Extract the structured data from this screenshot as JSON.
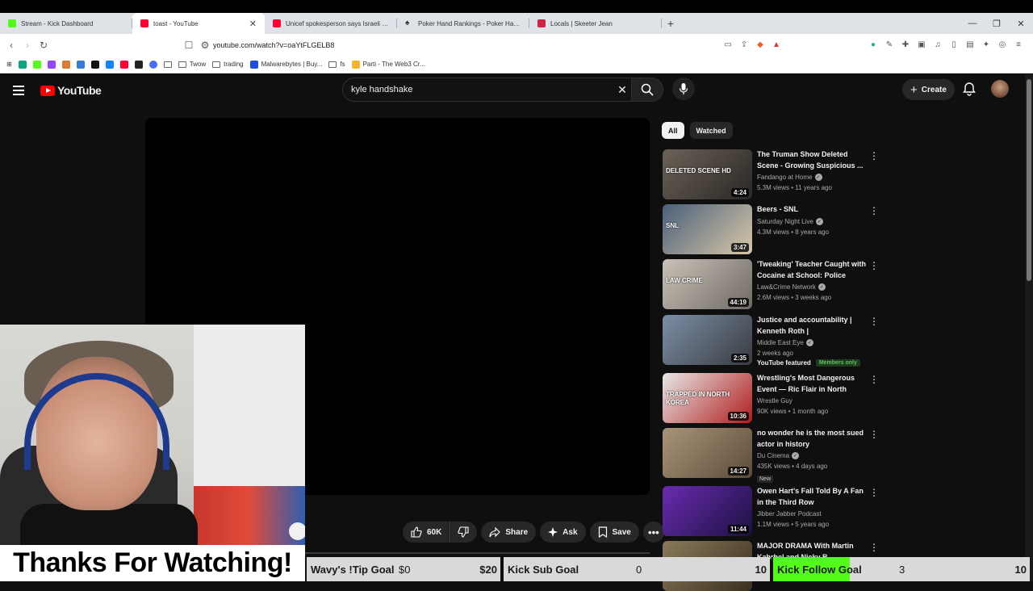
{
  "browser": {
    "tabs": [
      {
        "label": "Stream - Kick Dashboard",
        "color": "#53fc18",
        "active": false
      },
      {
        "label": "toast - YouTube",
        "color": "#ff0033",
        "active": true
      },
      {
        "label": "Unicef spokesperson says Israeli qua",
        "color": "#ff0033",
        "active": false
      },
      {
        "label": "Poker Hand Rankings - Poker Hands",
        "color": "#444444",
        "active": false
      },
      {
        "label": "Locals | Skeeter Jean",
        "color": "#cc2244",
        "active": false
      }
    ],
    "url": "youtube.com/watch?v=oaYtFLGELB8",
    "bookmarks": [
      {
        "label": "",
        "icon": "folder-icon"
      },
      {
        "label": "Twow",
        "icon": "folder-icon"
      },
      {
        "label": "trading",
        "icon": "folder-icon"
      },
      {
        "label": "Malwarebytes | Buy...",
        "icon": "malwarebytes-icon"
      },
      {
        "label": "fs",
        "icon": "folder-icon"
      },
      {
        "label": "Parti - The Web3 Cr...",
        "icon": "parti-icon"
      }
    ]
  },
  "youtube": {
    "logo_text": "YouTube",
    "search_value": "kyle handshake",
    "create_label": "Create",
    "chips": [
      "All",
      "Watched"
    ],
    "actions": {
      "likes": "60K",
      "share": "Share",
      "ask": "Ask",
      "save": "Save"
    },
    "related": [
      {
        "title": "The Truman Show Deleted Scene - Growing Suspicious ...",
        "channel": "Fandango at Home",
        "verified": true,
        "stats": "5.3M views • 11 years ago",
        "duration": "4:24",
        "thumb": [
          "#6b6257",
          "#2b2725"
        ],
        "thumb_text": "DELETED SCENE HD"
      },
      {
        "title": "Beers - SNL",
        "channel": "Saturday Night Live",
        "verified": true,
        "stats": "4.3M views • 8 years ago",
        "duration": "3:47",
        "thumb": [
          "#4a5f7a",
          "#d9c8a8"
        ],
        "thumb_text": "SNL"
      },
      {
        "title": "'Tweaking' Teacher Caught with Cocaine at School: Police",
        "channel": "Law&Crime Network",
        "verified": true,
        "stats": "2.6M views • 3 weeks ago",
        "duration": "44:19",
        "thumb": [
          "#c9c2b8",
          "#6f6a63"
        ],
        "thumb_text": "LAW CRIME"
      },
      {
        "title": "Justice and accountability | Kenneth Roth | UNAPOLOGETIC",
        "channel": "Middle East Eye",
        "verified": true,
        "stats": "2 weeks ago",
        "duration": "2:35",
        "thumb": [
          "#7b8ea6",
          "#3a3c40"
        ],
        "thumb_text": "",
        "featured": "YouTube featured",
        "members": "Members only"
      },
      {
        "title": "Wrestling's Most Dangerous Event — Ric Flair in North Korea",
        "channel": "Wrestle Guy",
        "verified": false,
        "stats": "90K views • 1 month ago",
        "duration": "10:36",
        "thumb": [
          "#e8e8e8",
          "#b01d1d"
        ],
        "thumb_text": "TRAPPED IN NORTH KOREA"
      },
      {
        "title": "no wonder he is the most sued actor in history",
        "channel": "Du Cinema",
        "verified": true,
        "stats": "435K views • 4 days ago",
        "duration": "14:27",
        "thumb": [
          "#a89478",
          "#5c4c3a"
        ],
        "thumb_text": "",
        "badge": "New"
      },
      {
        "title": "Owen Hart's Fall Told By A Fan in the Third Row",
        "channel": "Jibber Jabber Podcast",
        "verified": false,
        "stats": "1.1M views • 5 years ago",
        "duration": "11:44",
        "thumb": [
          "#6a2bb0",
          "#1b1240"
        ],
        "thumb_text": ""
      },
      {
        "title": "MAJOR DRAMA With Martin Kabrhel and Nicky B",
        "channel": "",
        "verified": false,
        "stats": "",
        "duration": "",
        "thumb": [
          "#8a7a5a",
          "#3a3020"
        ],
        "thumb_text": ""
      }
    ]
  },
  "overlay": {
    "thanks": "Thanks For Watching!",
    "goals": [
      {
        "name": "Wavy's !Tip Goal",
        "current": "$0",
        "target": "$20",
        "progress": 0
      },
      {
        "name": "Kick Sub Goal",
        "current": "0",
        "target": "10",
        "progress": 0
      },
      {
        "name": "Kick Follow Goal",
        "current": "3",
        "target": "10",
        "progress": 0.3
      }
    ]
  }
}
